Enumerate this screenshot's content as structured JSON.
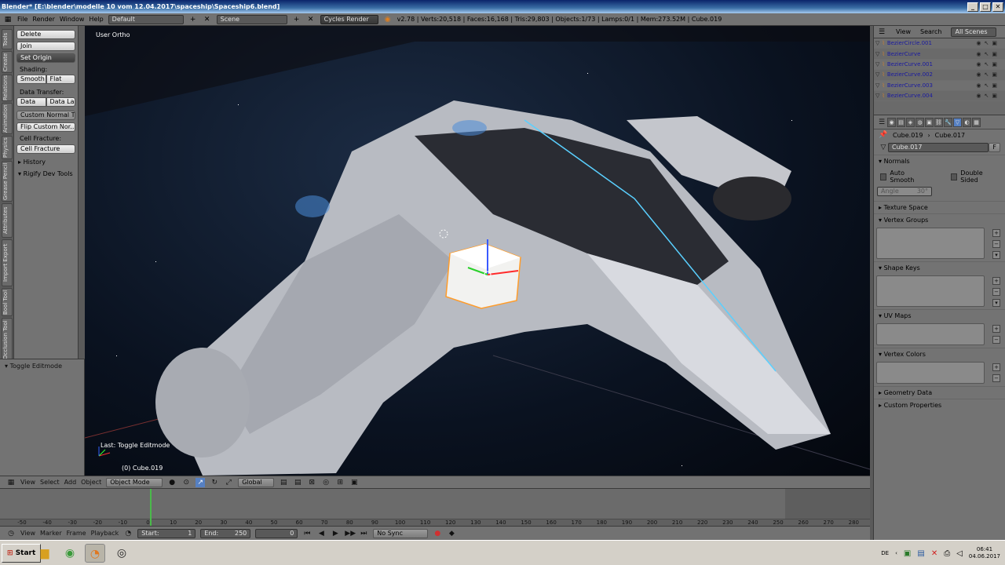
{
  "window": {
    "title": "Blender* [E:\\blender\\modelle 10 vom 12.04.2017\\spaceship\\Spaceship6.blend]",
    "buttons": [
      "_",
      "□",
      "✕"
    ]
  },
  "info_header": {
    "menus": [
      "File",
      "Render",
      "Window",
      "Help"
    ],
    "layout": "Default",
    "scene": "Scene",
    "engine": "Cycles Render",
    "stats": "v2.78 | Verts:20,518 | Faces:16,168 | Tris:29,803 | Objects:1/73 | Lamps:0/1 | Mem:273.52M | Cube.019"
  },
  "left_tabs": [
    "Tools",
    "Create",
    "Relations",
    "Animation",
    "Physics",
    "Grease Pencil",
    "Attributes",
    "Import Export",
    "Bool Tool",
    "Occlusion Tool"
  ],
  "tool_shelf": {
    "delete": "Delete",
    "join": "Join",
    "set_origin": "Set Origin",
    "shading_label": "Shading:",
    "smooth": "Smooth",
    "flat": "Flat",
    "data_transfer_label": "Data Transfer:",
    "data": "Data",
    "data_la": "Data La",
    "custom_normal": "Custom Normal T...",
    "flip_custom": "Flip Custom Nor...",
    "cell_fracture_label": "Cell Fracture:",
    "cell_fracture": "Cell Fracture",
    "history": "History",
    "rigify": "Rigify Dev Tools",
    "toggle_editmode": "Toggle Editmode"
  },
  "viewport": {
    "mode_label": "User Ortho",
    "last_op": "Last: Toggle Editmode",
    "active_obj": "(0) Cube.019"
  },
  "view3d_header": {
    "menus": [
      "View",
      "Select",
      "Add",
      "Object"
    ],
    "mode": "Object Mode",
    "orientation": "Global"
  },
  "timeline": {
    "ticks": [
      "-50",
      "-40",
      "-30",
      "-20",
      "-10",
      "0",
      "10",
      "20",
      "30",
      "40",
      "50",
      "60",
      "70",
      "80",
      "90",
      "100",
      "110",
      "120",
      "130",
      "140",
      "150",
      "160",
      "170",
      "180",
      "190",
      "200",
      "210",
      "220",
      "230",
      "240",
      "250",
      "260",
      "270",
      "280"
    ],
    "current_frame": 0,
    "menus": [
      "View",
      "Marker",
      "Frame",
      "Playback"
    ],
    "start": "Start:",
    "start_val": "1",
    "end": "End:",
    "end_val": "250",
    "frame": "0",
    "sync": "No Sync"
  },
  "outliner": {
    "menus": [
      "View",
      "Search",
      "All Scenes"
    ],
    "items": [
      "BezierCircle.001",
      "BezierCurve",
      "BezierCurve.001",
      "BezierCurve.002",
      "BezierCurve.003",
      "BezierCurve.004"
    ]
  },
  "properties": {
    "crumb_obj": "Cube.019",
    "crumb_mesh": "Cube.017",
    "mesh_name": "Cube.017",
    "fake_user": "F",
    "normals": "Normals",
    "auto_smooth": "Auto Smooth",
    "double_sided": "Double Sided",
    "angle": "Angle",
    "angle_val": "30°",
    "texture_space": "Texture Space",
    "vertex_groups": "Vertex Groups",
    "shape_keys": "Shape Keys",
    "uv_maps": "UV Maps",
    "vertex_colors": "Vertex Colors",
    "geometry_data": "Geometry Data",
    "custom_properties": "Custom Properties"
  },
  "taskbar": {
    "start": "Start",
    "lang": "DE",
    "time": "06:41",
    "date": "04.06.2017"
  },
  "colors": {
    "accent": "#5680c2",
    "timeline_cursor": "#4aba4a"
  }
}
